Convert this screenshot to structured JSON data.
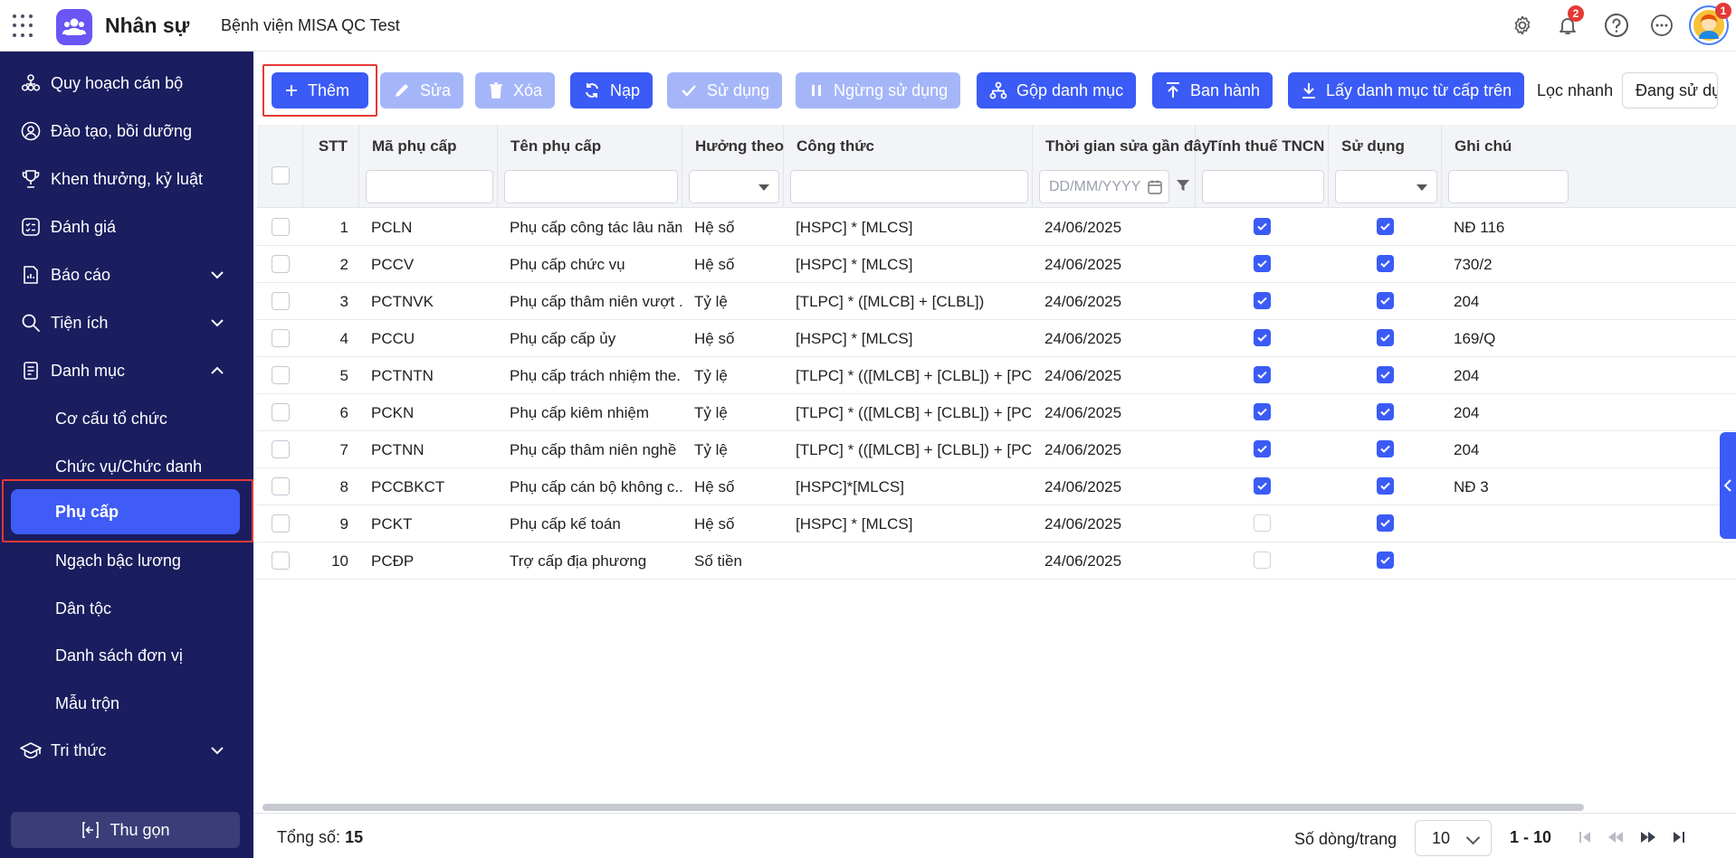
{
  "header": {
    "app_name": "Nhân sự",
    "org_name": "Bệnh viện MISA QC Test",
    "notification_count": "2",
    "avatar_badge_count": "1"
  },
  "sidebar": {
    "items": [
      {
        "label": "Quy hoạch cán bộ",
        "icon": "org-chart-icon"
      },
      {
        "label": "Đào tạo, bồi dưỡng",
        "icon": "user-circle-icon"
      },
      {
        "label": "Khen thưởng, kỷ luật",
        "icon": "trophy-icon"
      },
      {
        "label": "Đánh giá",
        "icon": "checklist-icon"
      },
      {
        "label": "Báo cáo",
        "icon": "report-icon"
      },
      {
        "label": "Tiện ích",
        "icon": "search-icon"
      },
      {
        "label": "Danh mục",
        "icon": "document-icon"
      }
    ],
    "sub_items": [
      {
        "label": "Cơ cấu tổ chức"
      },
      {
        "label": "Chức vụ/Chức danh"
      },
      {
        "label": "Phụ cấp"
      },
      {
        "label": "Ngạch bậc lương"
      },
      {
        "label": "Dân tộc"
      },
      {
        "label": "Danh sách đơn vị"
      },
      {
        "label": "Mẫu trộn"
      }
    ],
    "last_item": {
      "label": "Tri thức",
      "icon": "graduation-cap-icon"
    },
    "collapse_label": "Thu gọn"
  },
  "toolbar": {
    "add": "Thêm",
    "edit": "Sửa",
    "delete": "Xóa",
    "reload": "Nạp",
    "use": "Sử dụng",
    "stop_use": "Ngừng sử dụng",
    "merge": "Gộp danh mục",
    "publish": "Ban hành",
    "fetch_parent": "Lấy danh mục từ cấp trên",
    "quick_filter_label": "Lọc nhanh",
    "quick_filter_value": "Đang sử dụng"
  },
  "table": {
    "columns": {
      "stt": "STT",
      "code": "Mã phụ cấp",
      "name": "Tên phụ cấp",
      "type": "Hưởng theo",
      "formula": "Công thức",
      "modified": "Thời gian sửa gần đây",
      "tax": "Tính thuế TNCN",
      "in_use": "Sử dụng",
      "note": "Ghi chú"
    },
    "date_placeholder": "DD/MM/YYYY",
    "rows": [
      {
        "stt": "1",
        "code": "PCLN",
        "name": "Phụ cấp công tác lâu năm",
        "type": "Hệ số",
        "formula": "[HSPC] * [MLCS]",
        "modified": "24/06/2025",
        "tax": true,
        "in_use": true,
        "note": "NĐ 116"
      },
      {
        "stt": "2",
        "code": "PCCV",
        "name": "Phụ cấp chức vụ",
        "type": "Hệ số",
        "formula": "[HSPC] * [MLCS]",
        "modified": "24/06/2025",
        "tax": true,
        "in_use": true,
        "note": "730/2"
      },
      {
        "stt": "3",
        "code": "PCTNVK",
        "name": "Phụ cấp thâm niên vượt ...",
        "type": "Tỷ lệ",
        "formula": "[TLPC] * ([MLCB] + [CLBL])",
        "modified": "24/06/2025",
        "tax": true,
        "in_use": true,
        "note": "204"
      },
      {
        "stt": "4",
        "code": "PCCU",
        "name": "Phụ cấp cấp ủy",
        "type": "Hệ số",
        "formula": "[HSPC] * [MLCS]",
        "modified": "24/06/2025",
        "tax": true,
        "in_use": true,
        "note": "169/Q"
      },
      {
        "stt": "5",
        "code": "PCTNTN",
        "name": "Phụ cấp trách nhiệm the...",
        "type": "Tỷ lệ",
        "formula": "[TLPC] * (([MLCB] + [CLBL]) + [PC...",
        "modified": "24/06/2025",
        "tax": true,
        "in_use": true,
        "note": "204"
      },
      {
        "stt": "6",
        "code": "PCKN",
        "name": "Phụ cấp kiêm nhiệm",
        "type": "Tỷ lệ",
        "formula": "[TLPC] * (([MLCB] + [CLBL]) + [PC...",
        "modified": "24/06/2025",
        "tax": true,
        "in_use": true,
        "note": "204"
      },
      {
        "stt": "7",
        "code": "PCTNN",
        "name": "Phụ cấp thâm niên nghề",
        "type": "Tỷ lệ",
        "formula": "[TLPC] * (([MLCB] + [CLBL]) + [PC...",
        "modified": "24/06/2025",
        "tax": true,
        "in_use": true,
        "note": "204"
      },
      {
        "stt": "8",
        "code": "PCCBKCT",
        "name": "Phụ cấp cán bộ không c...",
        "type": "Hệ số",
        "formula": "[HSPC]*[MLCS]",
        "modified": "24/06/2025",
        "tax": true,
        "in_use": true,
        "note": "NĐ 3"
      },
      {
        "stt": "9",
        "code": "PCKT",
        "name": "Phụ cấp kế toán",
        "type": "Hệ số",
        "formula": "[HSPC] * [MLCS]",
        "modified": "24/06/2025",
        "tax": false,
        "in_use": true,
        "note": ""
      },
      {
        "stt": "10",
        "code": "PCĐP",
        "name": "Trợ cấp địa phương",
        "type": "Số tiền",
        "formula": "",
        "modified": "24/06/2025",
        "tax": false,
        "in_use": true,
        "note": ""
      }
    ]
  },
  "footer": {
    "total_label": "Tổng số:",
    "total_value": "15",
    "rows_per_page_label": "Số dòng/trang",
    "page_size": "10",
    "page_range": "1 - 10"
  },
  "colors": {
    "sidebar_bg": "#1a1d5e",
    "accent": "#3b5bf6",
    "accent_disabled": "#a5b6f8",
    "highlight_outline": "#e53935"
  }
}
